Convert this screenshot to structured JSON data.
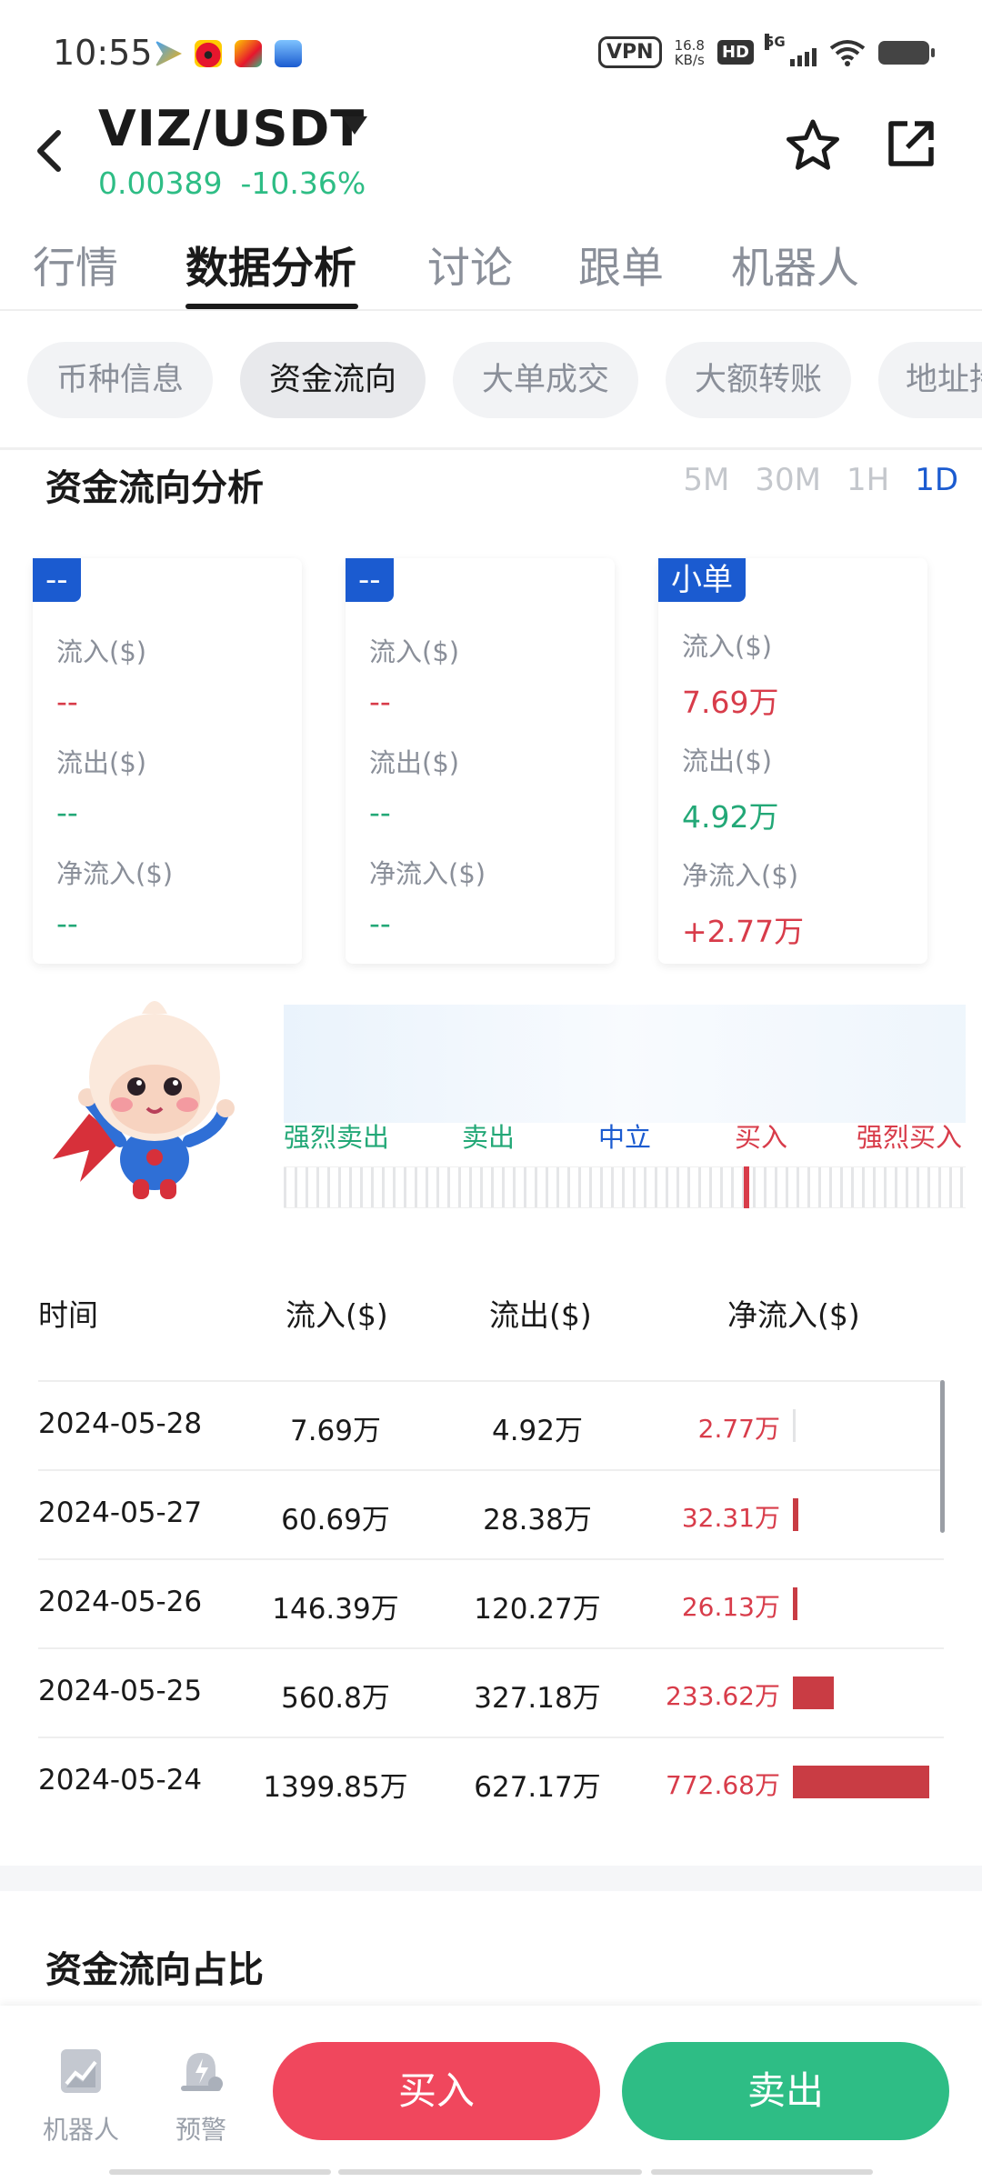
{
  "status_bar": {
    "time": "10:55",
    "vpn": "VPN",
    "speed_value": "16.8",
    "speed_unit": "KB/s",
    "hd": "HD",
    "network": "5G",
    "apps": [
      "video-app-icon",
      "weibo-icon",
      "game-app-icon",
      "cloud-app-icon"
    ]
  },
  "header": {
    "pair": "VIZ/USDT",
    "price": "0.00389",
    "change": "-10.36%",
    "price_color": "#2ebd85"
  },
  "main_tabs": [
    {
      "label": "行情",
      "active": false
    },
    {
      "label": "数据分析",
      "active": true
    },
    {
      "label": "讨论",
      "active": false
    },
    {
      "label": "跟单",
      "active": false
    },
    {
      "label": "机器人",
      "active": false
    }
  ],
  "sub_tabs": [
    {
      "label": "币种信息",
      "active": false
    },
    {
      "label": "资金流向",
      "active": true
    },
    {
      "label": "大单成交",
      "active": false
    },
    {
      "label": "大额转账",
      "active": false
    },
    {
      "label": "地址持",
      "active": false
    }
  ],
  "section": {
    "title": "资金流向分析",
    "periods": [
      "5M",
      "30M",
      "1H",
      "1D"
    ],
    "active_period": "1D"
  },
  "cards": [
    {
      "tag": "--",
      "inflow_label": "流入($)",
      "inflow": "--",
      "outflow_label": "流出($)",
      "outflow": "--",
      "net_label": "净流入($)",
      "net": "--"
    },
    {
      "tag": "--",
      "inflow_label": "流入($)",
      "inflow": "--",
      "outflow_label": "流出($)",
      "outflow": "--",
      "net_label": "净流入($)",
      "net": "--"
    },
    {
      "tag": "小单",
      "inflow_label": "流入($)",
      "inflow": "7.69万",
      "outflow_label": "流出($)",
      "outflow": "4.92万",
      "net_label": "净流入($)",
      "net": "+2.77万"
    }
  ],
  "sentiment": {
    "labels": [
      "强烈卖出",
      "卖出",
      "中立",
      "买入",
      "强烈买入"
    ],
    "label_colors": [
      "#23a877",
      "#23a877",
      "#1b5bd0",
      "#d83c4a",
      "#d83c4a"
    ],
    "marker_position": 0.675
  },
  "table": {
    "headers": [
      "时间",
      "流入($)",
      "流出($)",
      "净流入($)"
    ],
    "rows": [
      {
        "date": "2024-05-28",
        "inflow": "7.69万",
        "outflow": "4.92万",
        "net": "2.77万",
        "net_value": 2.77
      },
      {
        "date": "2024-05-27",
        "inflow": "60.69万",
        "outflow": "28.38万",
        "net": "32.31万",
        "net_value": 32.31
      },
      {
        "date": "2024-05-26",
        "inflow": "146.39万",
        "outflow": "120.27万",
        "net": "26.13万",
        "net_value": 26.13
      },
      {
        "date": "2024-05-25",
        "inflow": "560.8万",
        "outflow": "327.18万",
        "net": "233.62万",
        "net_value": 233.62
      },
      {
        "date": "2024-05-24",
        "inflow": "1399.85万",
        "outflow": "627.17万",
        "net": "772.68万",
        "net_value": 772.68
      }
    ]
  },
  "section2": {
    "title": "资金流向占比"
  },
  "bottom_bar": {
    "robot_label": "机器人",
    "alert_label": "预警",
    "buy_label": "买入",
    "sell_label": "卖出"
  },
  "colors": {
    "accent_blue": "#1b5bd0",
    "up_red": "#d83c4a",
    "down_green": "#23a877",
    "buy_button": "#f0475d",
    "sell_button": "#2ebd85"
  }
}
